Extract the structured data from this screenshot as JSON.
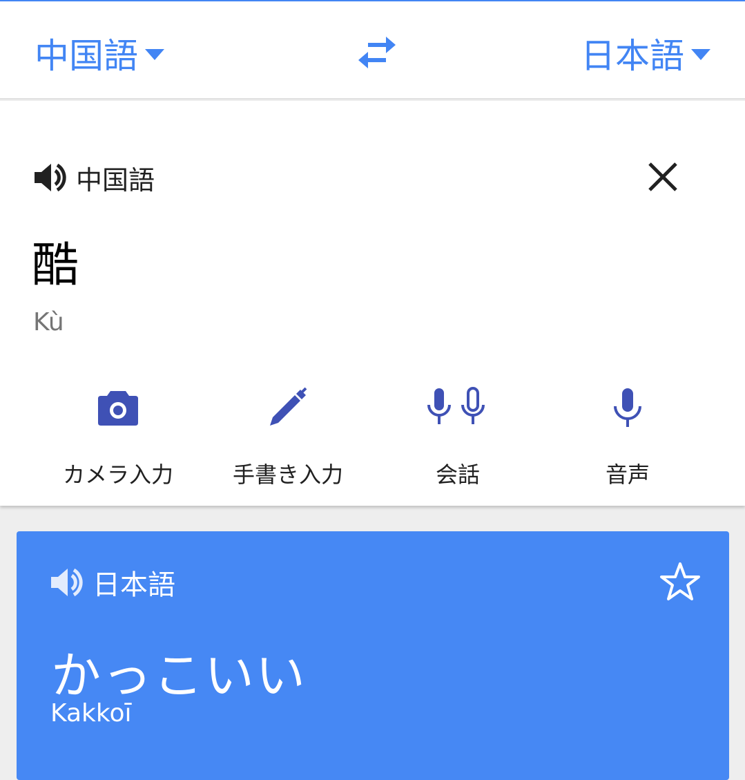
{
  "colors": {
    "accent": "#4285f4",
    "tool_icon": "#3f51b5",
    "result_bg": "#4688f4"
  },
  "langbar": {
    "source_lang": "中国語",
    "target_lang": "日本語",
    "swap_icon": "swap-arrows-icon"
  },
  "input": {
    "lang_label": "中国語",
    "text": "酷",
    "transliteration": "Kù"
  },
  "tools": [
    {
      "icon": "camera-icon",
      "label": "カメラ入力"
    },
    {
      "icon": "pen-icon",
      "label": "手書き入力"
    },
    {
      "icon": "conversation-mic-icon",
      "label": "会話"
    },
    {
      "icon": "mic-icon",
      "label": "音声"
    }
  ],
  "result": {
    "lang_label": "日本語",
    "text": "かっこいい",
    "transliteration": "Kakkoī"
  }
}
